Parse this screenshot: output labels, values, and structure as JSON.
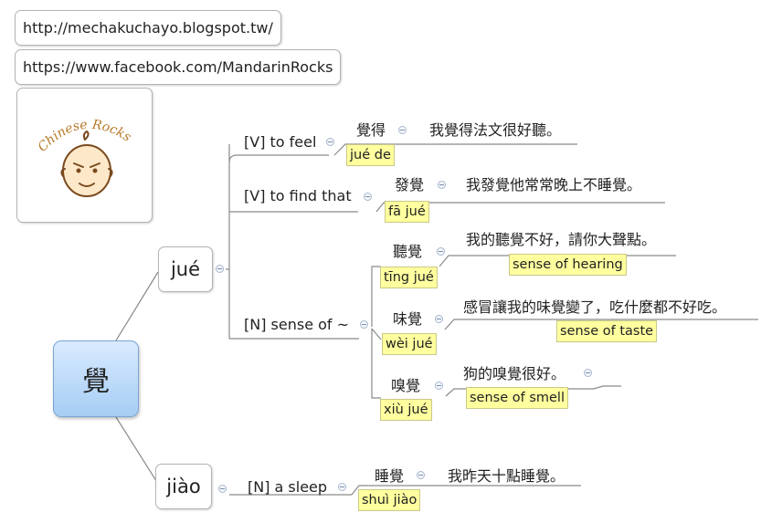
{
  "urls": [
    "http://mechakuchayo.blogspot.tw/",
    "https://www.facebook.com/MandarinRocks"
  ],
  "logo": {
    "text": "Chinese Rocks",
    "icon": "cartoon-face-icon"
  },
  "central": "覺",
  "branches": [
    {
      "reading": "jué",
      "meanings": [
        {
          "label": "[V] to feel",
          "word": "覺得",
          "pinyin": "jué de",
          "example": "我覺得法文很好聽。"
        },
        {
          "label": "[V] to find that",
          "word": "發覺",
          "pinyin": "fā jué",
          "example": "我發覺他常常晚上不睡覺。"
        },
        {
          "label": "[N] sense of ~",
          "subs": [
            {
              "word": "聽覺",
              "pinyin": "tīng jué",
              "example": "我的聽覺不好，請你大聲點。",
              "gloss": "sense of hearing"
            },
            {
              "word": "味覺",
              "pinyin": "wèi jué",
              "example": "感冒讓我的味覺變了，吃什麼都不好吃。",
              "gloss": "sense of taste"
            },
            {
              "word": "嗅覺",
              "pinyin": "xiù jué",
              "example": "狗的嗅覺很好。",
              "gloss": "sense of smell"
            }
          ]
        }
      ]
    },
    {
      "reading": "jiào",
      "meanings": [
        {
          "label": "[N] a sleep",
          "word": "睡覺",
          "pinyin": "shuì jiào",
          "example": "我昨天十點睡覺。"
        }
      ]
    }
  ],
  "colors": {
    "central_top": "#d9ebff",
    "central_bottom": "#a6cdf4",
    "highlight": "#ffff9f",
    "line": "#8a8a8a"
  }
}
